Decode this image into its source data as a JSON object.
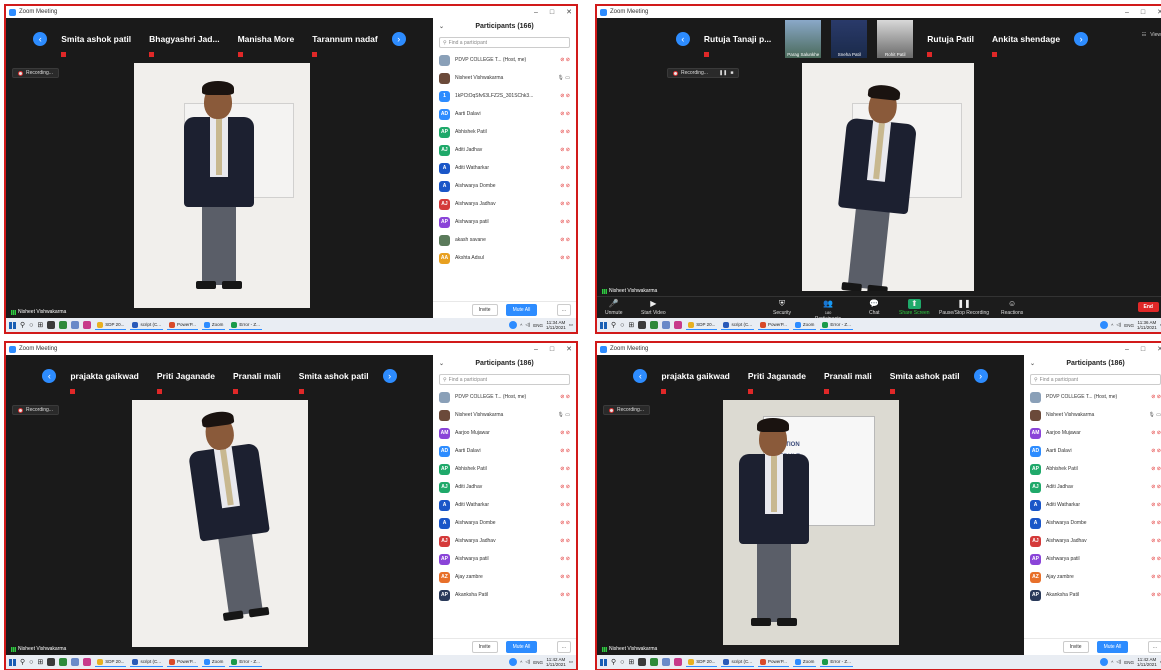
{
  "window_title": "Zoom Meeting",
  "window_controls": [
    "–",
    "□",
    "✕"
  ],
  "view_label": "View",
  "screenshots": [
    {
      "layout": "split",
      "strip": [
        "Smita ashok patil",
        "Bhagyashri  Jad...",
        "Manisha More",
        "Tarannum nadaf"
      ],
      "recording_label": "Recording...",
      "speaker": "Nisheet Vishwakarma",
      "panel": {
        "title": "Participants (166)",
        "search_placeholder": "Find a participant",
        "participants": [
          {
            "avatar": "img",
            "name": "PDVP COLLEGE T... (Host, me)",
            "color": "#8aa0b8"
          },
          {
            "avatar": "img",
            "name": "Nisheet Vishwakarma",
            "color": "#6b4a3a"
          },
          {
            "avatar": "1",
            "name": "1kPCtOqSfv63LFZ2S_301SChk3...",
            "color": "#2d8cff"
          },
          {
            "avatar": "AD",
            "name": "Aarti Dalavi",
            "color": "#2d8cff"
          },
          {
            "avatar": "AP",
            "name": "Abhishek Patil",
            "color": "#1fa96a"
          },
          {
            "avatar": "AJ",
            "name": "Aditi Jadhav",
            "color": "#1fa96a"
          },
          {
            "avatar": "A",
            "name": "Aditi Watharkar",
            "color": "#1a56c8"
          },
          {
            "avatar": "A",
            "name": "Aishwarya Dombe",
            "color": "#1a56c8"
          },
          {
            "avatar": "AJ",
            "name": "Aishwarya Jadhav",
            "color": "#d43a3a"
          },
          {
            "avatar": "AP",
            "name": "Aishwarya patil",
            "color": "#8a44d8"
          },
          {
            "avatar": "img",
            "name": "akash savane",
            "color": "#5a7a5a"
          },
          {
            "avatar": "AA",
            "name": "Akshta Adsul",
            "color": "#e8a020"
          }
        ],
        "invite": "Invite",
        "mute_all": "Mute All",
        "more": "..."
      },
      "taskbar": {
        "apps": [
          "SDP 20...",
          "script (C...",
          "PowerP...",
          "Zoom",
          "Error - Z..."
        ],
        "lang": "ENG",
        "time": "11:34 AM",
        "date": "1/11/2021"
      }
    },
    {
      "layout": "full",
      "strip": [
        "Rutuja Tanaji  p...",
        "Parag Salunkhe",
        "Sneha Patil",
        "Rohit Patil",
        "Rutuja Patil",
        "Ankita shendage"
      ],
      "recording_label": "Recording...",
      "speaker": "Nisheet Vishwakarma",
      "toolbar": {
        "items": [
          "Unmute",
          "Start Video",
          "Security",
          "Participants",
          "Chat",
          "Share Screen",
          "Pause/Stop Recording",
          "Reactions"
        ],
        "participant_count": "180",
        "end": "End"
      },
      "taskbar": {
        "apps": [
          "SDP 20...",
          "script (C...",
          "PowerP...",
          "Zoom",
          "Error - Z..."
        ],
        "lang": "ENG",
        "time": "11:36 AM",
        "date": "1/11/2021"
      }
    },
    {
      "layout": "split",
      "strip": [
        "prajakta gaikwad",
        "Priti Jaganade",
        "Pranali mali",
        "Smita ashok patil"
      ],
      "recording_label": "Recording...",
      "speaker": "Nisheet Vishwakarma",
      "panel": {
        "title": "Participants (186)",
        "search_placeholder": "Find a participant",
        "participants": [
          {
            "avatar": "img",
            "name": "PDVP COLLEGE T... (Host, me)",
            "color": "#8aa0b8"
          },
          {
            "avatar": "img",
            "name": "Nisheet Vishwakarma",
            "color": "#6b4a3a"
          },
          {
            "avatar": "AM",
            "name": "Aarjoo Mujawar",
            "color": "#8a44d8"
          },
          {
            "avatar": "AD",
            "name": "Aarti Dalavi",
            "color": "#2d8cff"
          },
          {
            "avatar": "AP",
            "name": "Abhishek Patil",
            "color": "#1fa96a"
          },
          {
            "avatar": "AJ",
            "name": "Aditi Jadhav",
            "color": "#1fa96a"
          },
          {
            "avatar": "A",
            "name": "Aditi Watharkar",
            "color": "#1a56c8"
          },
          {
            "avatar": "A",
            "name": "Aishwarya Dombe",
            "color": "#1a56c8"
          },
          {
            "avatar": "AJ",
            "name": "Aishwarya Jadhav",
            "color": "#d43a3a"
          },
          {
            "avatar": "AP",
            "name": "Aishwarya patil",
            "color": "#8a44d8"
          },
          {
            "avatar": "AZ",
            "name": "Ajay zambre",
            "color": "#e8702a"
          },
          {
            "avatar": "AP",
            "name": "Akanksha Patil",
            "color": "#2a3a5a"
          }
        ],
        "invite": "Invite",
        "mute_all": "Mute All",
        "more": "..."
      },
      "taskbar": {
        "apps": [
          "SDP 20...",
          "script (C...",
          "PowerP...",
          "Zoom",
          "Error - Z..."
        ],
        "lang": "ENG",
        "time": "11:42 AM",
        "date": "1/11/2021"
      }
    },
    {
      "layout": "split",
      "strip": [
        "prajakta gaikwad",
        "Priti Jaganade",
        "Pranali mali",
        "Smita ashok patil"
      ],
      "recording_label": "Recording...",
      "speaker": "Nisheet Vishwakarma",
      "panel": {
        "title": "Participants (186)",
        "search_placeholder": "Find a participant",
        "participants": [
          {
            "avatar": "img",
            "name": "PDVP COLLEGE T... (Host, me)",
            "color": "#8aa0b8"
          },
          {
            "avatar": "img",
            "name": "Nisheet Vishwakarma",
            "color": "#6b4a3a"
          },
          {
            "avatar": "AM",
            "name": "Aarjoo Mujawar",
            "color": "#8a44d8"
          },
          {
            "avatar": "AD",
            "name": "Aarti Dalavi",
            "color": "#2d8cff"
          },
          {
            "avatar": "AP",
            "name": "Abhishek Patil",
            "color": "#1fa96a"
          },
          {
            "avatar": "AJ",
            "name": "Aditi Jadhav",
            "color": "#1fa96a"
          },
          {
            "avatar": "A",
            "name": "Aditi Watharkar",
            "color": "#1a56c8"
          },
          {
            "avatar": "A",
            "name": "Aishwarya Dombe",
            "color": "#1a56c8"
          },
          {
            "avatar": "AJ",
            "name": "Aishwarya Jadhav",
            "color": "#d43a3a"
          },
          {
            "avatar": "AP",
            "name": "Aishwarya patil",
            "color": "#8a44d8"
          },
          {
            "avatar": "AZ",
            "name": "Ajay zambre",
            "color": "#e8702a"
          },
          {
            "avatar": "AP",
            "name": "Akanksha Patil",
            "color": "#2a3a5a"
          }
        ],
        "invite": "Invite",
        "mute_all": "Mute All",
        "more": "..."
      },
      "taskbar": {
        "apps": [
          "SDP 20...",
          "script (C...",
          "PowerP...",
          "Zoom",
          "Error - Z..."
        ],
        "lang": "ENG",
        "time": "11:42 AM",
        "date": "1/11/2021"
      }
    }
  ],
  "whiteboard_lines": [
    "CU",
    "INCEPTION",
    "SCHEDULE"
  ]
}
